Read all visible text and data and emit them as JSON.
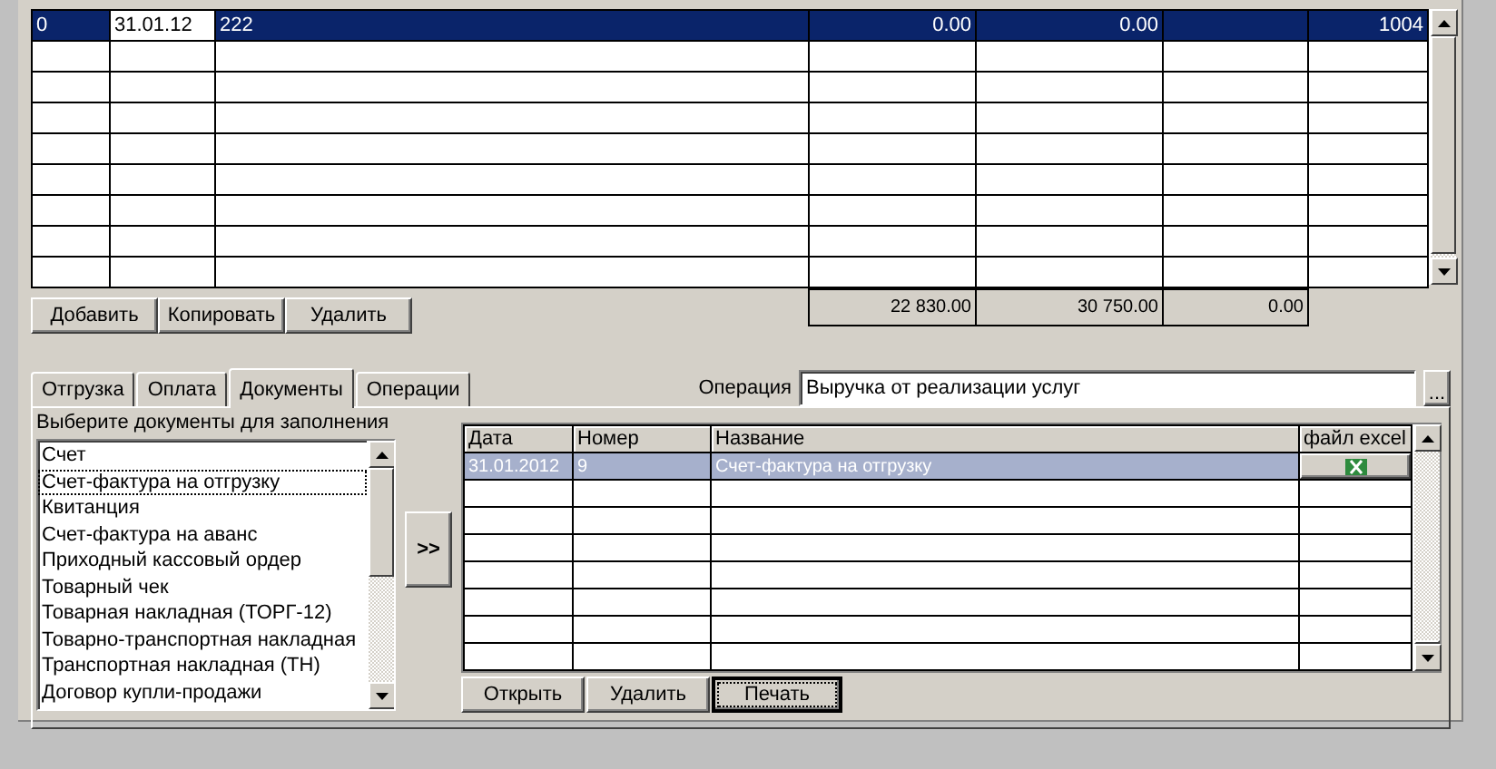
{
  "top_table": {
    "rows": [
      {
        "selected": true,
        "cells": [
          "0",
          "31.01.12",
          "222",
          "0.00",
          "0.00",
          "",
          "1004"
        ]
      },
      {
        "selected": false,
        "cells": []
      },
      {
        "selected": false,
        "cells": []
      },
      {
        "selected": false,
        "cells": []
      },
      {
        "selected": false,
        "cells": []
      },
      {
        "selected": false,
        "cells": []
      },
      {
        "selected": false,
        "cells": []
      },
      {
        "selected": false,
        "cells": []
      },
      {
        "selected": false,
        "cells": []
      }
    ],
    "totals": [
      "22 830.00",
      "30 750.00",
      "0.00"
    ]
  },
  "top_buttons": [
    "Добавить",
    "Копировать",
    "Удалить"
  ],
  "tabs": [
    {
      "label": "Отгрузка",
      "selected": false
    },
    {
      "label": "Оплата",
      "selected": false
    },
    {
      "label": "Документы",
      "selected": true
    },
    {
      "label": "Операции",
      "selected": false
    }
  ],
  "operation": {
    "label": "Операция",
    "value": "Выручка от реализации услуг",
    "browse": "..."
  },
  "doc_list": {
    "caption": "Выберите документы для заполнения",
    "items": [
      {
        "label": "Счет",
        "selected": false
      },
      {
        "label": "Счет-фактура на отгрузку",
        "selected": true
      },
      {
        "label": "Квитанция",
        "selected": false
      },
      {
        "label": "Счет-фактура на аванс",
        "selected": false
      },
      {
        "label": "Приходный кассовый ордер",
        "selected": false
      },
      {
        "label": "Товарный чек",
        "selected": false
      },
      {
        "label": "Товарная накладная (ТОРГ-12)",
        "selected": false
      },
      {
        "label": "Товарно-транспортная накладная",
        "selected": false
      },
      {
        "label": "Транспортная накладная (ТН)",
        "selected": false
      },
      {
        "label": "Договор купли-продажи",
        "selected": false
      }
    ]
  },
  "add_button": ">>",
  "docs_table": {
    "columns": [
      "Дата",
      "Номер",
      "Название",
      "файл excel"
    ],
    "rows": [
      {
        "selected": true,
        "cells": [
          "31.01.2012",
          "9",
          "Счет-фактура на отгрузку"
        ],
        "excel": true
      },
      {
        "selected": false,
        "cells": [],
        "excel": false
      },
      {
        "selected": false,
        "cells": [],
        "excel": false
      },
      {
        "selected": false,
        "cells": [],
        "excel": false
      },
      {
        "selected": false,
        "cells": [],
        "excel": false
      },
      {
        "selected": false,
        "cells": [],
        "excel": false
      },
      {
        "selected": false,
        "cells": [],
        "excel": false
      },
      {
        "selected": false,
        "cells": [],
        "excel": false
      }
    ]
  },
  "docs_buttons": [
    {
      "label": "Открыть",
      "focused": false
    },
    {
      "label": "Удалить",
      "focused": false
    },
    {
      "label": "Печать",
      "focused": true
    }
  ]
}
